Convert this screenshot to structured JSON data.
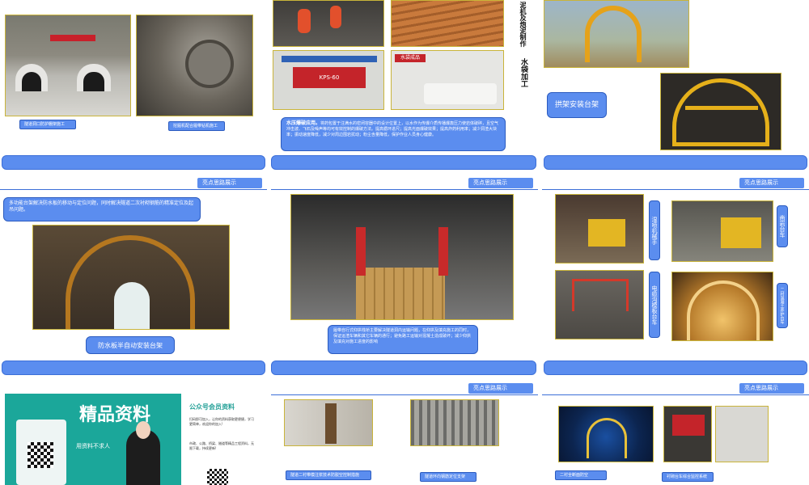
{
  "section_tag": "亮点思路展示",
  "slide1": {
    "caption_left": "隧道洞口防护棚架施工",
    "caption_right": "挖掘机配合履带钻机施工"
  },
  "slide2": {
    "vertical_title_1": "泥机及炮泥制作",
    "vertical_title_2": "水袋加工",
    "title_bold": "水压爆破应用。",
    "body": "将药包置于注满水的密闭容器中的设计位置上，以水作为传爆介质传播爆轰压力使岩体破碎，且空气冲击波、飞石及噪声等均可有效控制的爆破方法。提高循环进尺；提高光面爆破效果；提高炸药利用率；减少洞渣大块率；振动速度降低，减少对周边围岩扰动；粉尘含量降低，保护作业人员身心健康。",
    "machine_label": "KPS-60",
    "water_bag_label": "水袋成品"
  },
  "slide3": {
    "box": "拱架安装台架"
  },
  "slide4": {
    "description": "多功能台架解决防水板的移动与定位问题，同时解决隧道二次衬砌钢筋的精准定位及起吊问题。",
    "caption": "防水板半自动安装台架"
  },
  "slide5": {
    "caption": "履带自行式仰拱栈桥主要解决隧道洞内运输问题，在仰拱及填充施工的同时，保证运渣车辆和其它车辆的通行；避免路工运输对混凝土造成破坏；减少仰拱及填充对施工进度的影响"
  },
  "slide6": {
    "badge_1": "湿喷机械手",
    "badge_2": "凿岩台车",
    "badge_3": "电缆沟模板台车",
    "badge_4": "二衬混凝土养护台车"
  },
  "slide7": {
    "big_title": "精品资料",
    "sub_left": "用资料不求人",
    "qr_header": "公众号会员资料",
    "qr_note": "扫码即可加入，让你的资料获取更便捷，学习更简单，欢迎你的加入!",
    "qr_note2": "市政、公路、桥梁、隧道等精品工程资料，无限下载，持续更新!"
  },
  "slide8": {
    "caption_1": "隧道二衬带模注浆技术防脱空控制措施",
    "caption_2": "隧道环向钢筋定位支架"
  },
  "slide9": {
    "caption_1": "二衬全断面防空",
    "caption_2": "衬砌台车综合监控系统"
  }
}
